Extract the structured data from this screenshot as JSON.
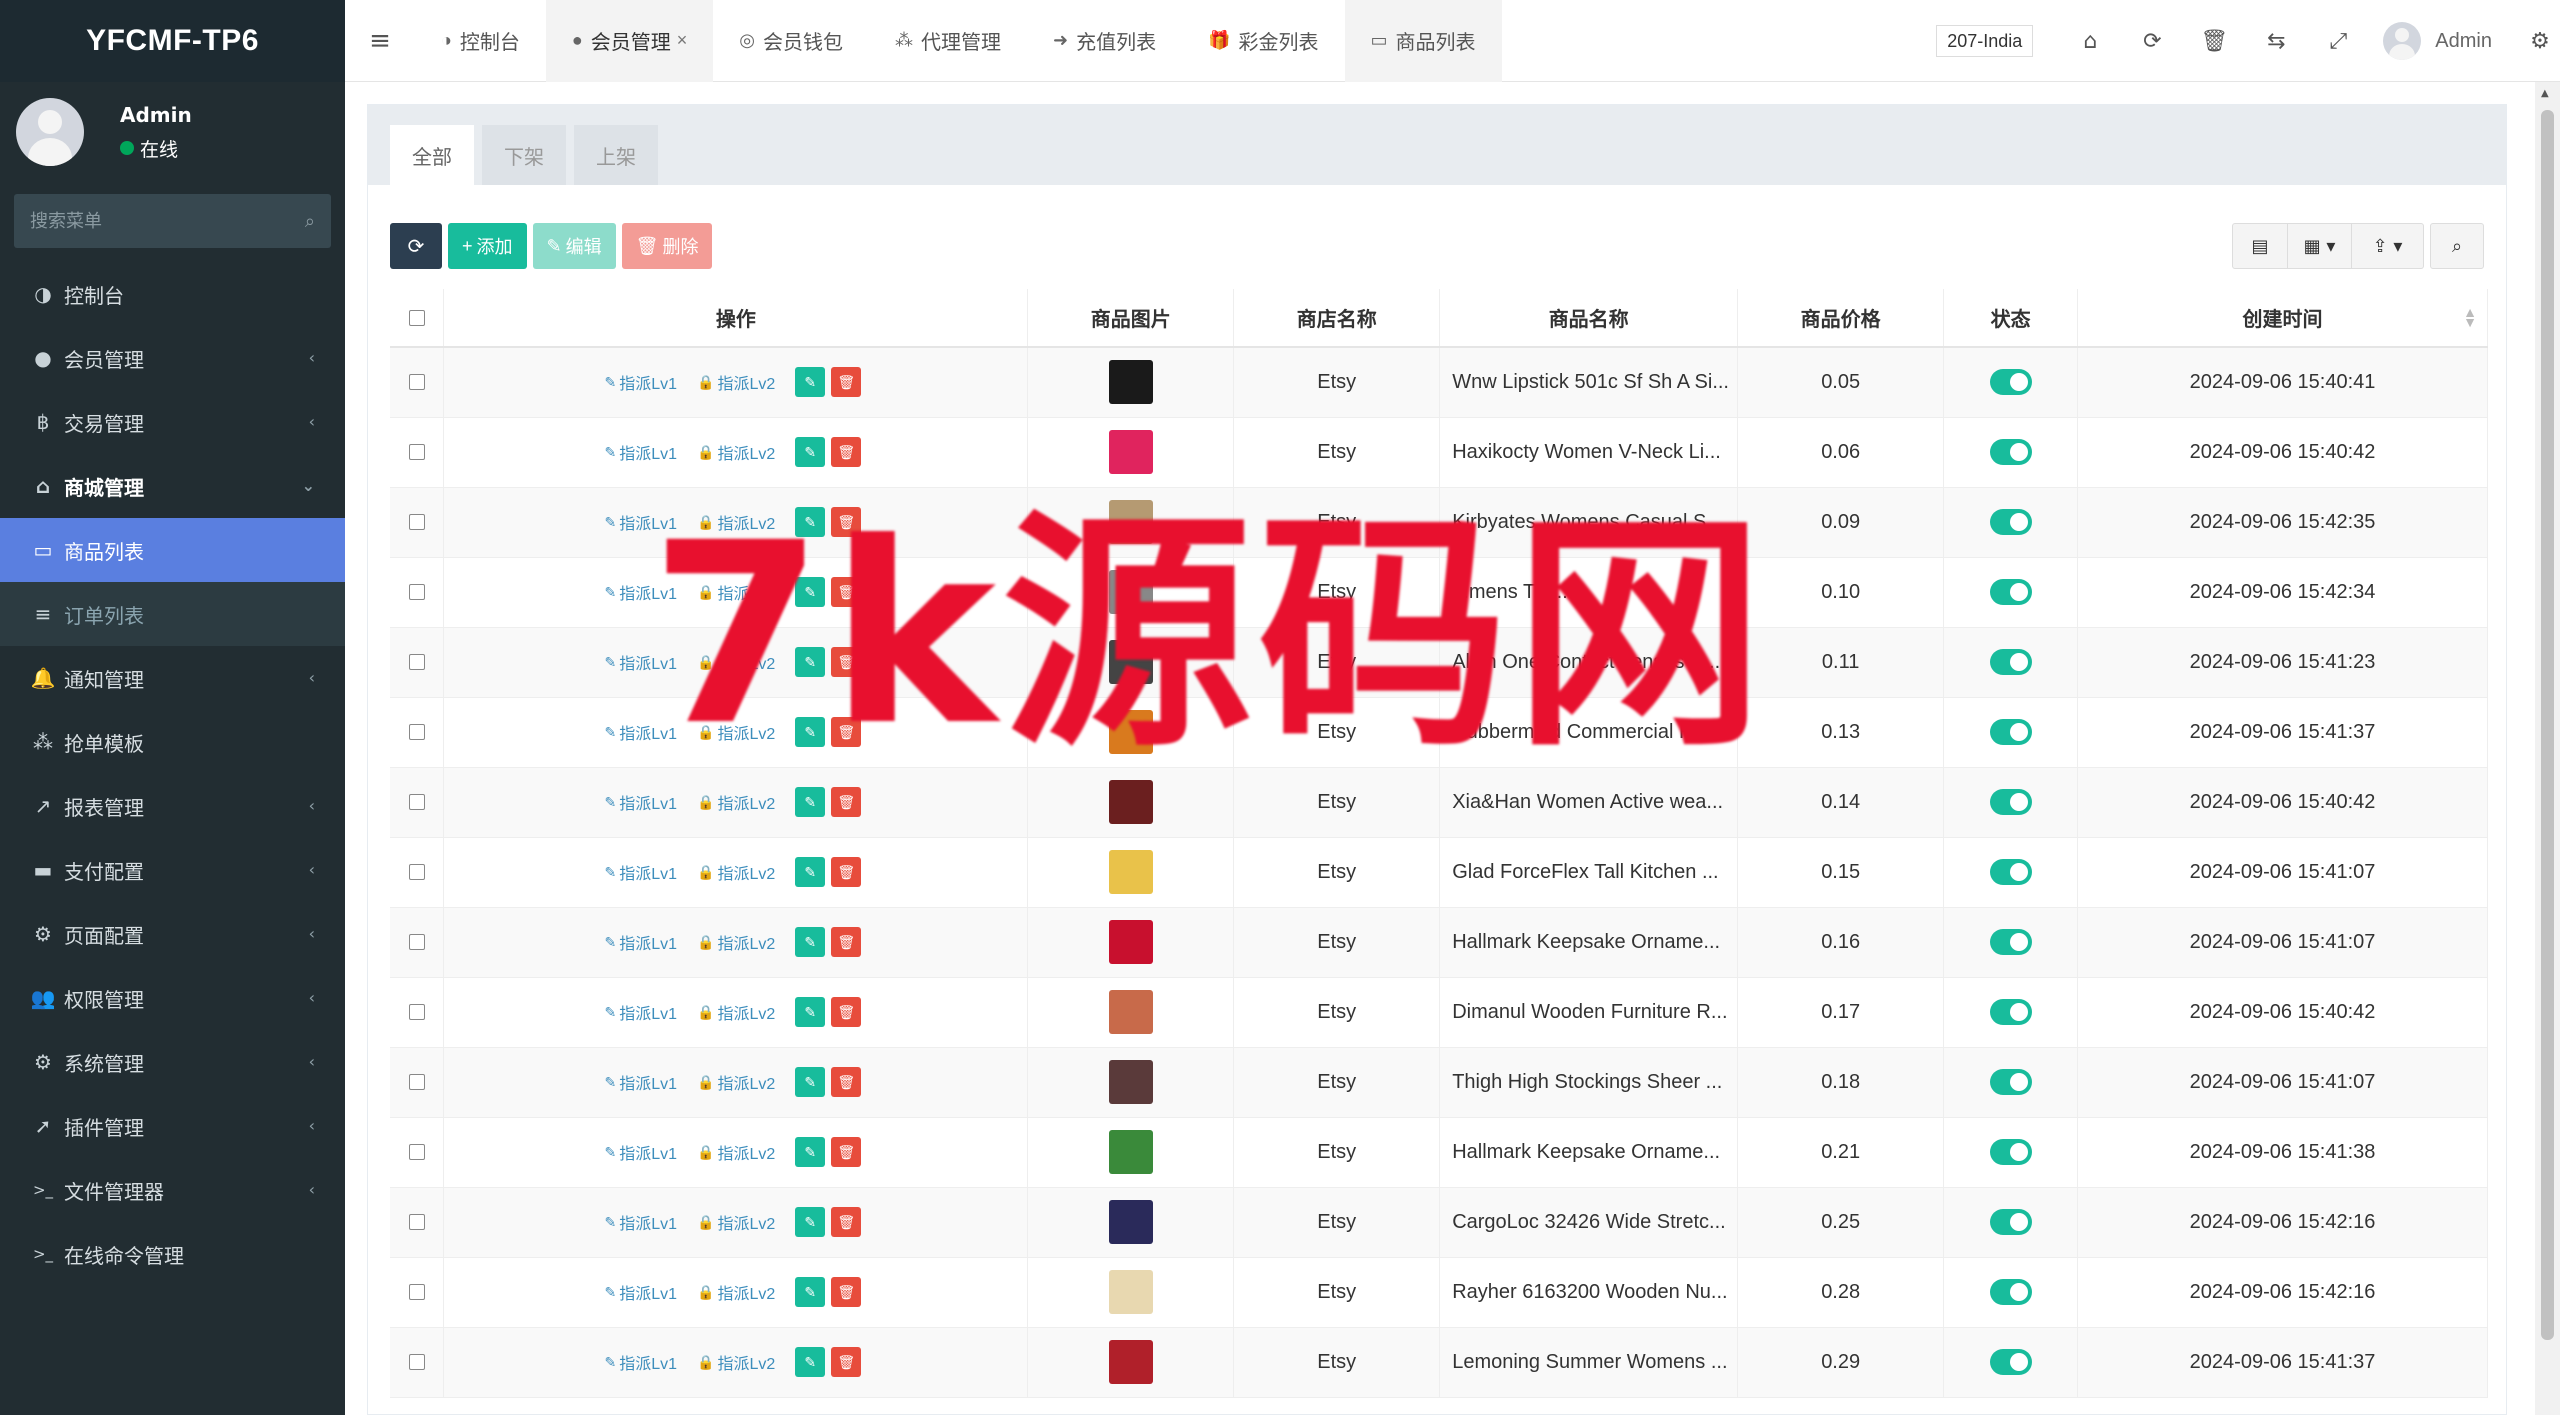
{
  "app": {
    "logo": "YFCMF-TP6"
  },
  "user": {
    "name": "Admin",
    "status": "在线"
  },
  "sidebar": {
    "search_placeholder": "搜索菜单",
    "items": [
      {
        "label": "控制台",
        "icon": "dashboard-icon",
        "glyph": "◑",
        "chev": ""
      },
      {
        "label": "会员管理",
        "icon": "user-icon",
        "glyph": "●",
        "chev": "‹"
      },
      {
        "label": "交易管理",
        "icon": "bitcoin-icon",
        "glyph": "฿",
        "chev": "‹"
      },
      {
        "label": "商城管理",
        "icon": "home-icon",
        "glyph": "⌂",
        "chev": "⌄",
        "open": true
      },
      {
        "label": "商品列表",
        "icon": "monitor-icon",
        "glyph": "▭",
        "chev": "",
        "active": true
      },
      {
        "label": "订单列表",
        "icon": "list-icon",
        "glyph": "≡",
        "chev": "",
        "sub": true
      },
      {
        "label": "通知管理",
        "icon": "bell-icon",
        "glyph": "🔔",
        "chev": "‹"
      },
      {
        "label": "抢单模板",
        "icon": "sitemap-icon",
        "glyph": "⁂",
        "chev": ""
      },
      {
        "label": "报表管理",
        "icon": "chart-icon",
        "glyph": "↗",
        "chev": "‹"
      },
      {
        "label": "支付配置",
        "icon": "card-icon",
        "glyph": "▬",
        "chev": "‹"
      },
      {
        "label": "页面配置",
        "icon": "gear-icon",
        "glyph": "⚙",
        "chev": "‹"
      },
      {
        "label": "权限管理",
        "icon": "users-icon",
        "glyph": "👥",
        "chev": "‹"
      },
      {
        "label": "系统管理",
        "icon": "cogs-icon",
        "glyph": "⚙",
        "chev": "‹"
      },
      {
        "label": "插件管理",
        "icon": "rocket-icon",
        "glyph": "➚",
        "chev": "‹"
      },
      {
        "label": "文件管理器",
        "icon": "terminal-icon",
        "glyph": ">_",
        "chev": "‹"
      },
      {
        "label": "在线命令管理",
        "icon": "terminal-icon",
        "glyph": ">_",
        "chev": ""
      }
    ]
  },
  "topbar": {
    "tabs": [
      {
        "label": "控制台",
        "icon": "dashboard-icon",
        "glyph": "◑"
      },
      {
        "label": "会员管理",
        "icon": "user-icon",
        "glyph": "●",
        "close": "×",
        "active": true
      },
      {
        "label": "会员钱包",
        "icon": "wallet-icon",
        "glyph": "◎"
      },
      {
        "label": "代理管理",
        "icon": "sitemap-icon",
        "glyph": "⁂"
      },
      {
        "label": "充值列表",
        "icon": "sign-in-icon",
        "glyph": "➜"
      },
      {
        "label": "彩金列表",
        "icon": "gift-icon",
        "glyph": "🎁"
      },
      {
        "label": "商品列表",
        "icon": "monitor-icon",
        "glyph": "▭",
        "current": true
      }
    ],
    "lang": "207-India",
    "admin_name": "Admin"
  },
  "panel": {
    "tabs": [
      "全部",
      "下架",
      "上架"
    ],
    "buttons": {
      "add": "添加",
      "edit": "编辑",
      "delete": "删除"
    }
  },
  "table": {
    "headers": [
      "操作",
      "商品图片",
      "商店名称",
      "商品名称",
      "商品价格",
      "状态",
      "创建时间"
    ],
    "op_lv1": "指派Lv1",
    "op_lv2": "指派Lv2",
    "rows": [
      {
        "shop": "Etsy",
        "name": "Wnw Lipstick 501c Sf Sh A Si...",
        "price": "0.05",
        "time": "2024-09-06 15:40:41",
        "color": "#1a1a1a"
      },
      {
        "shop": "Etsy",
        "name": "Haxikocty Women V-Neck Li...",
        "price": "0.06",
        "time": "2024-09-06 15:40:42",
        "color": "#e0245e"
      },
      {
        "shop": "Etsy",
        "name": "Kirbyates Womens Casual S...",
        "price": "0.09",
        "time": "2024-09-06 15:42:35",
        "color": "#b59a72"
      },
      {
        "shop": "Etsy",
        "name": "...mens Tur...",
        "price": "0.10",
        "time": "2024-09-06 15:42:34",
        "color": "#888"
      },
      {
        "shop": "Etsy",
        "name": "All In One Contact Lenses K...",
        "price": "0.11",
        "time": "2024-09-06 15:41:23",
        "color": "#444"
      },
      {
        "shop": "Etsy",
        "name": "Rubbermaid Commercial RC...",
        "price": "0.13",
        "time": "2024-09-06 15:41:37",
        "color": "#d97a1e"
      },
      {
        "shop": "Etsy",
        "name": "Xia&Han Women Active wea...",
        "price": "0.14",
        "time": "2024-09-06 15:40:42",
        "color": "#6b1f1f"
      },
      {
        "shop": "Etsy",
        "name": "Glad ForceFlex Tall Kitchen ...",
        "price": "0.15",
        "time": "2024-09-06 15:41:07",
        "color": "#e9c24a"
      },
      {
        "shop": "Etsy",
        "name": "Hallmark Keepsake Orname...",
        "price": "0.16",
        "time": "2024-09-06 15:41:07",
        "color": "#c8102e"
      },
      {
        "shop": "Etsy",
        "name": "Dimanul Wooden Furniture R...",
        "price": "0.17",
        "time": "2024-09-06 15:40:42",
        "color": "#c86a4a"
      },
      {
        "shop": "Etsy",
        "name": "Thigh High Stockings Sheer ...",
        "price": "0.18",
        "time": "2024-09-06 15:41:07",
        "color": "#5a3a3a"
      },
      {
        "shop": "Etsy",
        "name": "Hallmark Keepsake Orname...",
        "price": "0.21",
        "time": "2024-09-06 15:41:38",
        "color": "#3a8a3a"
      },
      {
        "shop": "Etsy",
        "name": "CargoLoc 32426 Wide Stretc...",
        "price": "0.25",
        "time": "2024-09-06 15:42:16",
        "color": "#2a2a5a"
      },
      {
        "shop": "Etsy",
        "name": "Rayher 6163200 Wooden Nu...",
        "price": "0.28",
        "time": "2024-09-06 15:42:16",
        "color": "#e8d8b0"
      },
      {
        "shop": "Etsy",
        "name": "Lemoning Summer Womens ...",
        "price": "0.29",
        "time": "2024-09-06 15:41:37",
        "color": "#b0202a"
      }
    ]
  },
  "watermark": "7k源码网",
  "colors": {
    "sidebar": "#222d32",
    "active": "#5a7fe0",
    "green": "#18bc9c",
    "red": "#e74c3c"
  }
}
